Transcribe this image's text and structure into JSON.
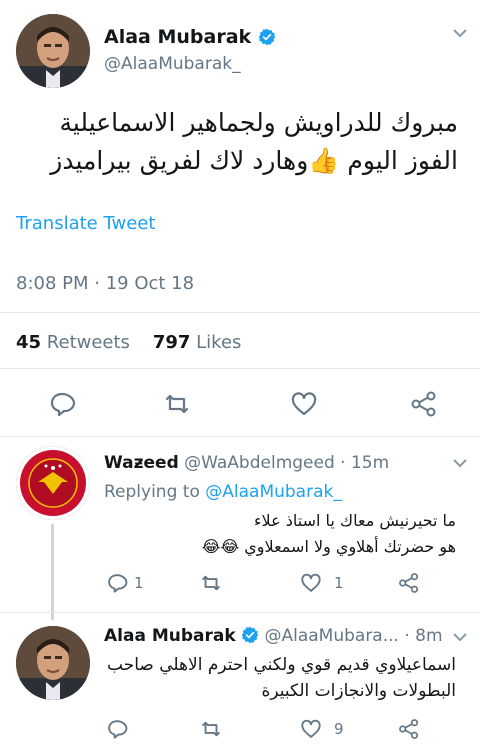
{
  "main_tweet": {
    "name": "Alaa Mubarak",
    "handle": "@AlaaMubarak_",
    "text_line1": "مبروك للدراويش  ولجماهير الاسماعيلية",
    "text_line2": "الفوز اليوم 👍وهارد لاك لفريق بيراميدز",
    "translate_label": "Translate Tweet",
    "timestamp": "8:08 PM · 19 Oct 18",
    "retweets_count": "45",
    "retweets_label": "Retweets",
    "likes_count": "797",
    "likes_label": "Likes"
  },
  "reply_1": {
    "name": "Waƶeed",
    "handle": "@WaAbdelmgeed",
    "time": "· 15m",
    "replying_prefix": "Replying to",
    "replying_handle": "@AlaaMubarak_",
    "text_line1": "ما تحيرنيش معاك يا استاذ علاء",
    "text_line2": "هو حضرتك أهلاوي ولا اسمعلاوي 😂😂",
    "reply_count": "1",
    "like_count": "1"
  },
  "reply_2": {
    "name": "Alaa Mubarak",
    "handle": "@AlaaMubara...",
    "time": "· 8m",
    "text_line1": "اسماعيلاوي قديم قوي ولكني احترم الاهلي  صاحب",
    "text_line2": "البطولات والانجازات الكبيرة",
    "like_count": "9"
  },
  "colors": {
    "accent": "#1da1f2",
    "secondary_text": "#657786",
    "divider": "#e1e8ed",
    "verified": "#1da1f2"
  },
  "icons": [
    "verified-badge-icon",
    "chevron-down-icon",
    "reply-icon",
    "retweet-icon",
    "like-icon",
    "share-icon"
  ]
}
